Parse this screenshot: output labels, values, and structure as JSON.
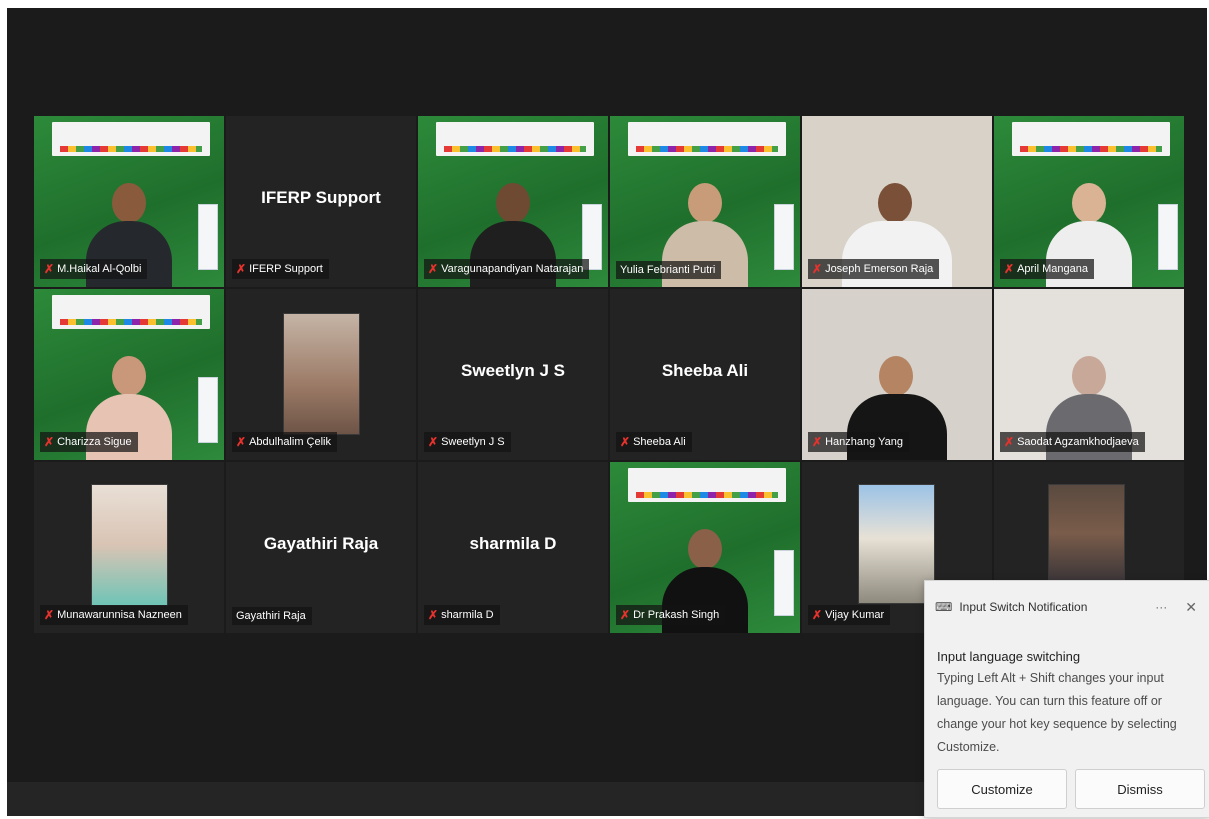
{
  "participants": [
    {
      "name": "M.Haikal Al-Qolbi",
      "muted": true
    },
    {
      "name": "IFERP Support",
      "muted": true,
      "display_name": "IFERP Support"
    },
    {
      "name": "Varagunapandiyan Natarajan",
      "muted": true
    },
    {
      "name": "Yulia Febrianti Putri",
      "muted": false
    },
    {
      "name": "Joseph Emerson Raja",
      "muted": true
    },
    {
      "name": "April Mangana",
      "muted": true
    },
    {
      "name": "Charizza Sigue",
      "muted": true
    },
    {
      "name": "Abdulhalim Çelik",
      "muted": true
    },
    {
      "name": "Sweetlyn J S",
      "muted": true,
      "display_name": "Sweetlyn J S"
    },
    {
      "name": "Sheeba Ali",
      "muted": true,
      "display_name": "Sheeba Ali"
    },
    {
      "name": "Hanzhang Yang",
      "muted": true
    },
    {
      "name": "Saodat Agzamkhodjaeva",
      "muted": true
    },
    {
      "name": "Munawarunnisa Nazneen",
      "muted": true
    },
    {
      "name": "Gayathiri Raja",
      "muted": false,
      "display_name": "Gayathiri Raja"
    },
    {
      "name": "sharmila D",
      "muted": true,
      "display_name": "sharmila D"
    },
    {
      "name": "Dr Prakash Singh",
      "muted": true
    },
    {
      "name": "Vijay Kumar",
      "muted": true
    }
  ],
  "mic_off_icon": "mic-off-icon",
  "notification": {
    "title": "Input Switch Notification",
    "more": "···",
    "close": "✕",
    "heading": "Input language switching",
    "body": "Typing Left Alt + Shift changes your input language. You can turn this feature off or change your hot key sequence by selecting Customize.",
    "customize_label": "Customize",
    "dismiss_label": "Dismiss"
  }
}
